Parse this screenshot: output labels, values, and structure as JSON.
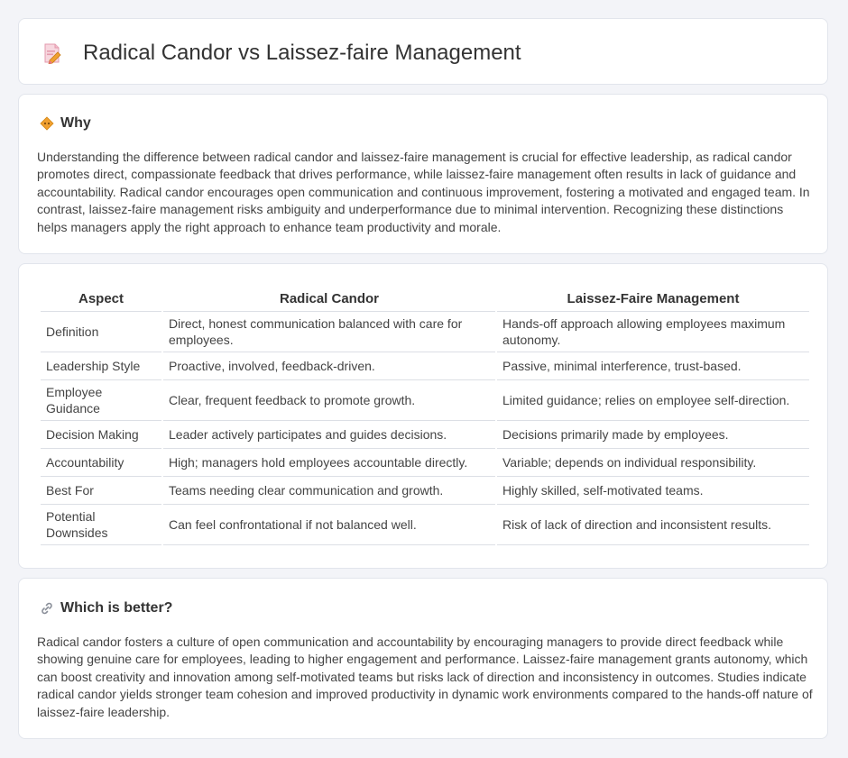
{
  "header": {
    "title": "Radical Candor vs Laissez-faire Management",
    "icon": "document-pencil-icon"
  },
  "why": {
    "heading": "Why",
    "icon": "diamond-warning-icon",
    "text": "Understanding the difference between radical candor and laissez-faire management is crucial for effective leadership, as radical candor promotes direct, compassionate feedback that drives performance, while laissez-faire management often results in lack of guidance and accountability. Radical candor encourages open communication and continuous improvement, fostering a motivated and engaged team. In contrast, laissez-faire management risks ambiguity and underperformance due to minimal intervention. Recognizing these distinctions helps managers apply the right approach to enhance team productivity and morale."
  },
  "comparison": {
    "headers": [
      "Aspect",
      "Radical Candor",
      "Laissez-Faire Management"
    ],
    "rows": [
      {
        "aspect": "Definition",
        "rc": "Direct, honest communication balanced with care for employees.",
        "lf": "Hands-off approach allowing employees maximum autonomy."
      },
      {
        "aspect": "Leadership Style",
        "rc": "Proactive, involved, feedback-driven.",
        "lf": "Passive, minimal interference, trust-based."
      },
      {
        "aspect": "Employee Guidance",
        "rc": "Clear, frequent feedback to promote growth.",
        "lf": "Limited guidance; relies on employee self-direction."
      },
      {
        "aspect": "Decision Making",
        "rc": "Leader actively participates and guides decisions.",
        "lf": "Decisions primarily made by employees."
      },
      {
        "aspect": "Accountability",
        "rc": "High; managers hold employees accountable directly.",
        "lf": "Variable; depends on individual responsibility."
      },
      {
        "aspect": "Best For",
        "rc": "Teams needing clear communication and growth.",
        "lf": "Highly skilled, self-motivated teams."
      },
      {
        "aspect": "Potential Downsides",
        "rc": "Can feel confrontational if not balanced well.",
        "lf": "Risk of lack of direction and inconsistent results."
      }
    ]
  },
  "better": {
    "heading": "Which is better?",
    "icon": "link-icon",
    "text": "Radical candor fosters a culture of open communication and accountability by encouraging managers to provide direct feedback while showing genuine care for employees, leading to higher engagement and performance. Laissez-faire management grants autonomy, which can boost creativity and innovation among self-motivated teams but risks lack of direction and inconsistency in outcomes. Studies indicate radical candor yields stronger team cohesion and improved productivity in dynamic work environments compared to the hands-off nature of laissez-faire leadership."
  },
  "colors": {
    "background": "#f3f4f8",
    "card": "#ffffff",
    "accent": "#f0a030",
    "icon_pink": "#e8708a"
  }
}
